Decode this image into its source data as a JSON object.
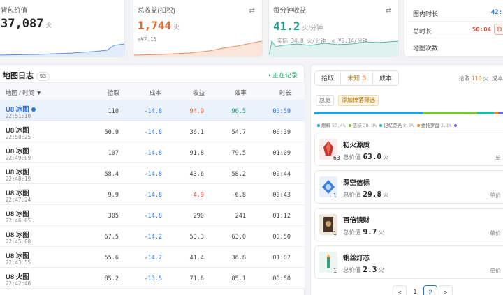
{
  "stats": {
    "backpack": {
      "title": "背包价值",
      "value": "37,087",
      "unit": "火"
    },
    "total": {
      "title": "总收益(扣税)",
      "value": "1,744",
      "unit": "火",
      "sub": "◎¥7.15",
      "color": "#e4652f"
    },
    "per_min": {
      "title": "每分钟收益",
      "value": "41.2",
      "unit": "火/分钟",
      "sub_actual": "实际 34.8 火/分钟",
      "sub_rmb": "◎ ¥0.14/分钟",
      "color": "#1d9a86"
    },
    "time": {
      "rows": [
        {
          "label": "图内时长",
          "value": "42:",
          "color": "#2f6fd1"
        },
        {
          "label": "总时长",
          "value": "50:04",
          "color": "#d9412f"
        },
        {
          "label": "地图次数",
          "value": ""
        }
      ],
      "pause_glyph": "D"
    }
  },
  "log": {
    "title": "地图日志",
    "count": "53",
    "recording": "• 正在记录",
    "columns": [
      "地图 / 时间 ▼",
      "拾取",
      "成本",
      "收益",
      "效率",
      "时长"
    ],
    "rows": [
      {
        "map": "U8 冰图",
        "time": "22:51:10",
        "pick": "110",
        "cost": "-14.8",
        "profit": "94.9",
        "eff": "96.5",
        "dur": "00:59",
        "active": true
      },
      {
        "map": "U8 冰图",
        "time": "22:50:25",
        "pick": "50.9",
        "cost": "-14.8",
        "profit": "36.1",
        "eff": "54.7",
        "dur": "00:39"
      },
      {
        "map": "U8 冰图",
        "time": "22:49:09",
        "pick": "107",
        "cost": "-14.8",
        "profit": "91.8",
        "eff": "79.5",
        "dur": "01:09"
      },
      {
        "map": "U8 冰图",
        "time": "22:48:19",
        "pick": "58.4",
        "cost": "-14.8",
        "profit": "43.6",
        "eff": "58.2",
        "dur": "00:44"
      },
      {
        "map": "U8 冰图",
        "time": "22:47:24",
        "pick": "9.9",
        "cost": "-14.8",
        "profit": "-4.9",
        "eff": "-6.8",
        "dur": "00:43",
        "neg": true
      },
      {
        "map": "U8 冰图",
        "time": "22:46:05",
        "pick": "305",
        "cost": "-14.8",
        "profit": "290",
        "eff": "241",
        "dur": "01:12"
      },
      {
        "map": "U8 冰图",
        "time": "22:45:08",
        "pick": "67.5",
        "cost": "-14.2",
        "profit": "53.3",
        "eff": "63.0",
        "dur": "00:50"
      },
      {
        "map": "U8 冰图",
        "time": "22:43:55",
        "pick": "55.6",
        "cost": "-14.2",
        "profit": "41.4",
        "eff": "36.8",
        "dur": "01:07"
      },
      {
        "map": "U8 火图",
        "time": "22:42:46",
        "pick": "85.2",
        "cost": "-13.5",
        "profit": "71.6",
        "eff": "85.1",
        "dur": "00:50"
      }
    ]
  },
  "drops": {
    "tabs": [
      {
        "label": "拾取",
        "selected": true
      },
      {
        "label": "未知",
        "num": "3",
        "warn": true
      },
      {
        "label": "成本"
      }
    ],
    "summary": "拾取 110 火  成本",
    "chips": [
      "总览",
      "添加掉落筛选"
    ],
    "bar": [
      {
        "color": "#2a9fd6",
        "pct": 57.4
      },
      {
        "color": "#7cc242",
        "pct": 28.9
      },
      {
        "color": "#25b7a4",
        "pct": 8.9
      },
      {
        "color": "#f08b2b",
        "pct": 2.1
      },
      {
        "color": "#6f6ad8",
        "pct": 2.7
      }
    ],
    "legend": [
      {
        "name": "燃料",
        "pct": "57.4%",
        "color": "#2a9fd6"
      },
      {
        "name": "信标",
        "pct": "28.9%",
        "color": "#7cc242"
      },
      {
        "name": "记忆荧光",
        "pct": "8.9%",
        "color": "#25b7a4"
      },
      {
        "name": "委托罗盘",
        "pct": "2.1%",
        "color": "#f08b2b"
      },
      {
        "name": "",
        "pct": "",
        "color": "#6f6ad8"
      }
    ],
    "items": [
      {
        "name": "初火源质",
        "qty": "63",
        "label": "总价值",
        "value": "63.0",
        "unit": "火",
        "right": "单",
        "icon": "ember-crystal-icon"
      },
      {
        "name": "深空信标",
        "qty": "1",
        "label": "总价值",
        "value": "29.8",
        "unit": "火",
        "right": "单价",
        "icon": "beacon-icon"
      },
      {
        "name": "百倍镜财",
        "qty": "1",
        "label": "总价值",
        "value": "9.7",
        "unit": "火",
        "right": "单价",
        "icon": "card-icon"
      },
      {
        "name": "铜丝灯芯",
        "qty": "1",
        "label": "总价值",
        "value": "2.3",
        "unit": "火",
        "right": "单价",
        "icon": "wick-icon"
      }
    ],
    "pager": {
      "prev": "<",
      "pages": [
        "1",
        "2"
      ],
      "next": ">"
    }
  }
}
